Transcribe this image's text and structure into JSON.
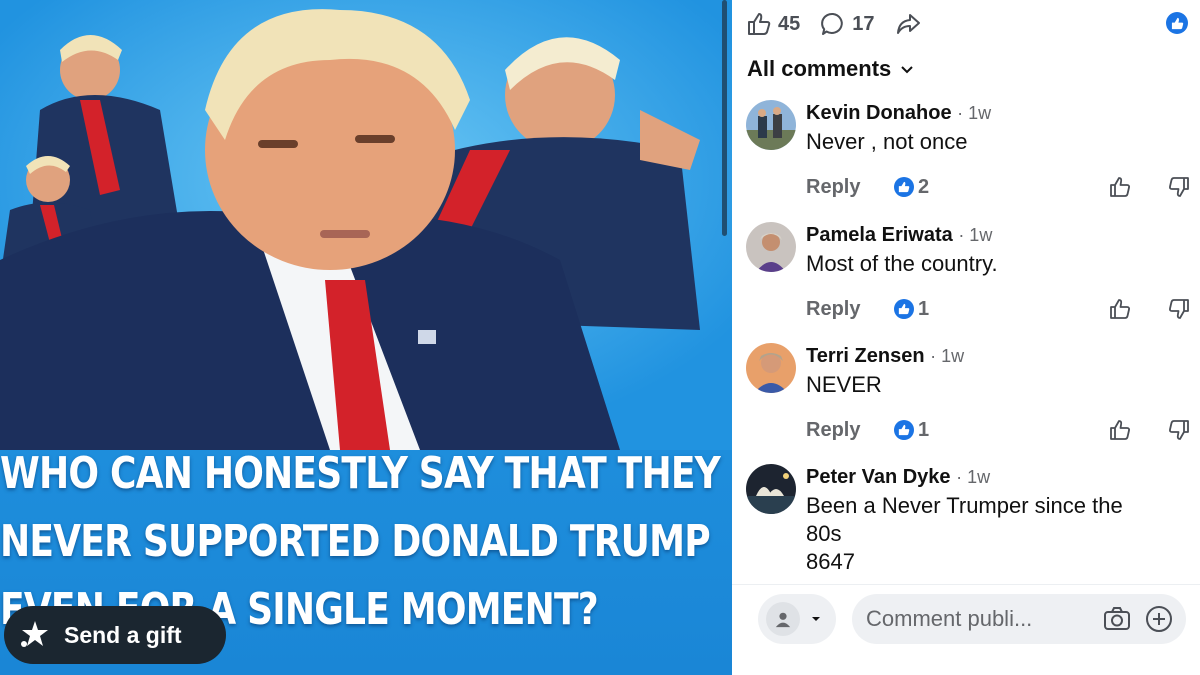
{
  "media": {
    "caption_lines": [
      "WHO CAN HONESTLY SAY THAT THEY",
      "NEVER SUPPORTED DONALD TRUMP",
      "EVEN FOR A SINGLE MOMENT?"
    ],
    "gift_button_label": "Send a gift"
  },
  "reactions": {
    "likes": "45",
    "comments": "17"
  },
  "comments_header": "All comments",
  "comments": [
    {
      "name": "Kevin Donahoe",
      "time": "· 1w",
      "text": "Never , not once",
      "reply_label": "Reply",
      "likes": "2"
    },
    {
      "name": "Pamela Eriwata",
      "time": "· 1w",
      "text": "Most of the country.",
      "reply_label": "Reply",
      "likes": "1"
    },
    {
      "name": "Terri Zensen",
      "time": "· 1w",
      "text": "NEVER",
      "reply_label": "Reply",
      "likes": "1"
    },
    {
      "name": "Peter Van Dyke",
      "time": "· 1w",
      "text_lines": [
        "Been a Never Trumper since the",
        "80s",
        "8647"
      ]
    }
  ],
  "composer": {
    "placeholder": "Comment publi..."
  },
  "colors": {
    "accent": "#1b74e4",
    "media_bg": "#2193e0",
    "gift_button_bg": "#1b2630"
  },
  "icons": [
    "like-icon",
    "comment-icon",
    "share-icon",
    "chevron-down-icon",
    "upvote-icon",
    "downvote-icon",
    "camera-icon",
    "add-icon",
    "gift-icon",
    "person-icon"
  ]
}
